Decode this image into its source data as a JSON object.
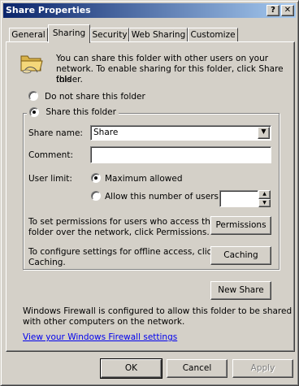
{
  "window": {
    "title": "Share Properties",
    "help_label": "?",
    "close_label": "✕"
  },
  "tabs": [
    {
      "label": "General"
    },
    {
      "label": "Sharing"
    },
    {
      "label": "Security"
    },
    {
      "label": "Web Sharing"
    },
    {
      "label": "Customize"
    }
  ],
  "intro": {
    "line1": "You can share this folder with other users on your",
    "line2": "network.  To enable sharing for this folder, click Share this",
    "line3": "folder."
  },
  "share_options": {
    "do_not_share_label": "Do not share this folder",
    "share_label": "Share this folder",
    "selected": "Share this folder"
  },
  "share_name": {
    "label": "Share name:",
    "value": "Share"
  },
  "comment": {
    "label": "Comment:",
    "value": ""
  },
  "user_limit": {
    "label": "User limit:",
    "max_label": "Maximum allowed",
    "allow_label": "Allow this number of users:",
    "selected": "Maximum allowed",
    "number_value": ""
  },
  "permissions": {
    "text_line1": "To set permissions for users who access this",
    "text_line2": "folder over the network, click Permissions.",
    "button_label": "Permissions"
  },
  "caching": {
    "text_line1": "To configure settings for offline access, click",
    "text_line2": "Caching.",
    "button_label": "Caching"
  },
  "new_share_label": "New Share",
  "firewall": {
    "text_line1": "Windows Firewall is configured to allow this folder to be shared",
    "text_line2": "with other computers on the network.",
    "link_label": "View your Windows Firewall settings"
  },
  "footer": {
    "ok_label": "OK",
    "cancel_label": "Cancel",
    "apply_label": "Apply"
  }
}
